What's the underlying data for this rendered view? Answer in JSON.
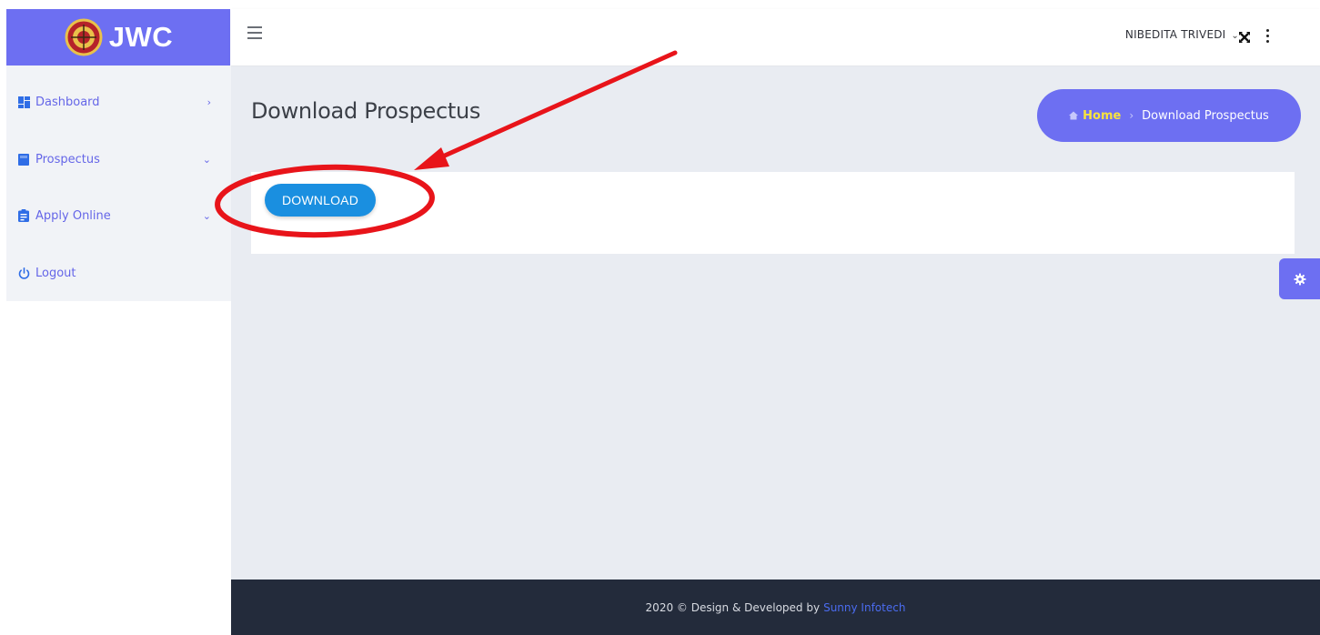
{
  "brand": {
    "logo_text": "JWC",
    "color": "#6d6ff2"
  },
  "topbar": {
    "menu_icon": "hamburger-icon",
    "user_name": "NIBEDITA TRIVEDI",
    "user_caret": "⌄",
    "fullscreen_icon": "fullscreen-icon",
    "more_icon": "kebab-icon"
  },
  "sidebar": {
    "items": [
      {
        "label": "Dashboard",
        "icon": "dashboard-grid-icon",
        "arrow": "›"
      },
      {
        "label": "Prospectus",
        "icon": "book-icon",
        "arrow": "⌄"
      },
      {
        "label": "Apply Online",
        "icon": "clipboard-icon",
        "arrow": "⌄"
      },
      {
        "label": "Logout",
        "icon": "power-icon",
        "arrow": ""
      }
    ]
  },
  "page": {
    "title": "Download Prospectus",
    "breadcrumb": {
      "home": "Home",
      "separator": "›",
      "current": "Download Prospectus"
    },
    "download_button": "DOWNLOAD",
    "settings_icon": "gear-icon"
  },
  "footer": {
    "text": "2020 © Design & Developed by",
    "link": "Sunny Infotech"
  },
  "annotation": {
    "color": "#e8141a",
    "shapes": [
      "ellipse",
      "arrow"
    ]
  }
}
